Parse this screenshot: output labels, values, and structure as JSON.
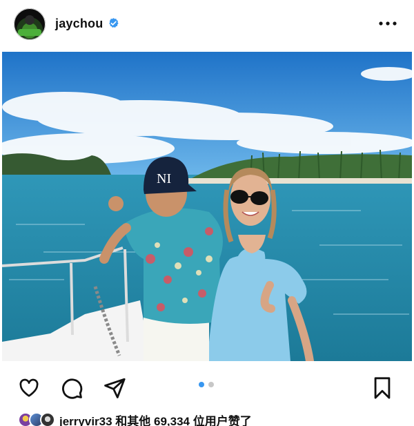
{
  "post": {
    "username": "jaychou",
    "verified": true,
    "verified_icon": "verified-badge-icon",
    "more_icon": "more-options-icon",
    "photo_alt": "",
    "carousel": {
      "count": 2,
      "current": 1
    },
    "actions": {
      "like_icon": "heart-icon",
      "comment_icon": "comment-icon",
      "share_icon": "paper-plane-icon",
      "save_icon": "bookmark-icon"
    },
    "likes": {
      "first_liker": "jerryvir33",
      "text": "jerryvir33 和其他 69,334 位用户赞了"
    }
  },
  "colors": {
    "verified_blue": "#3897f0",
    "carousel_active": "#3897f0",
    "carousel_inactive": "#c7c7c7",
    "text": "#111111"
  }
}
